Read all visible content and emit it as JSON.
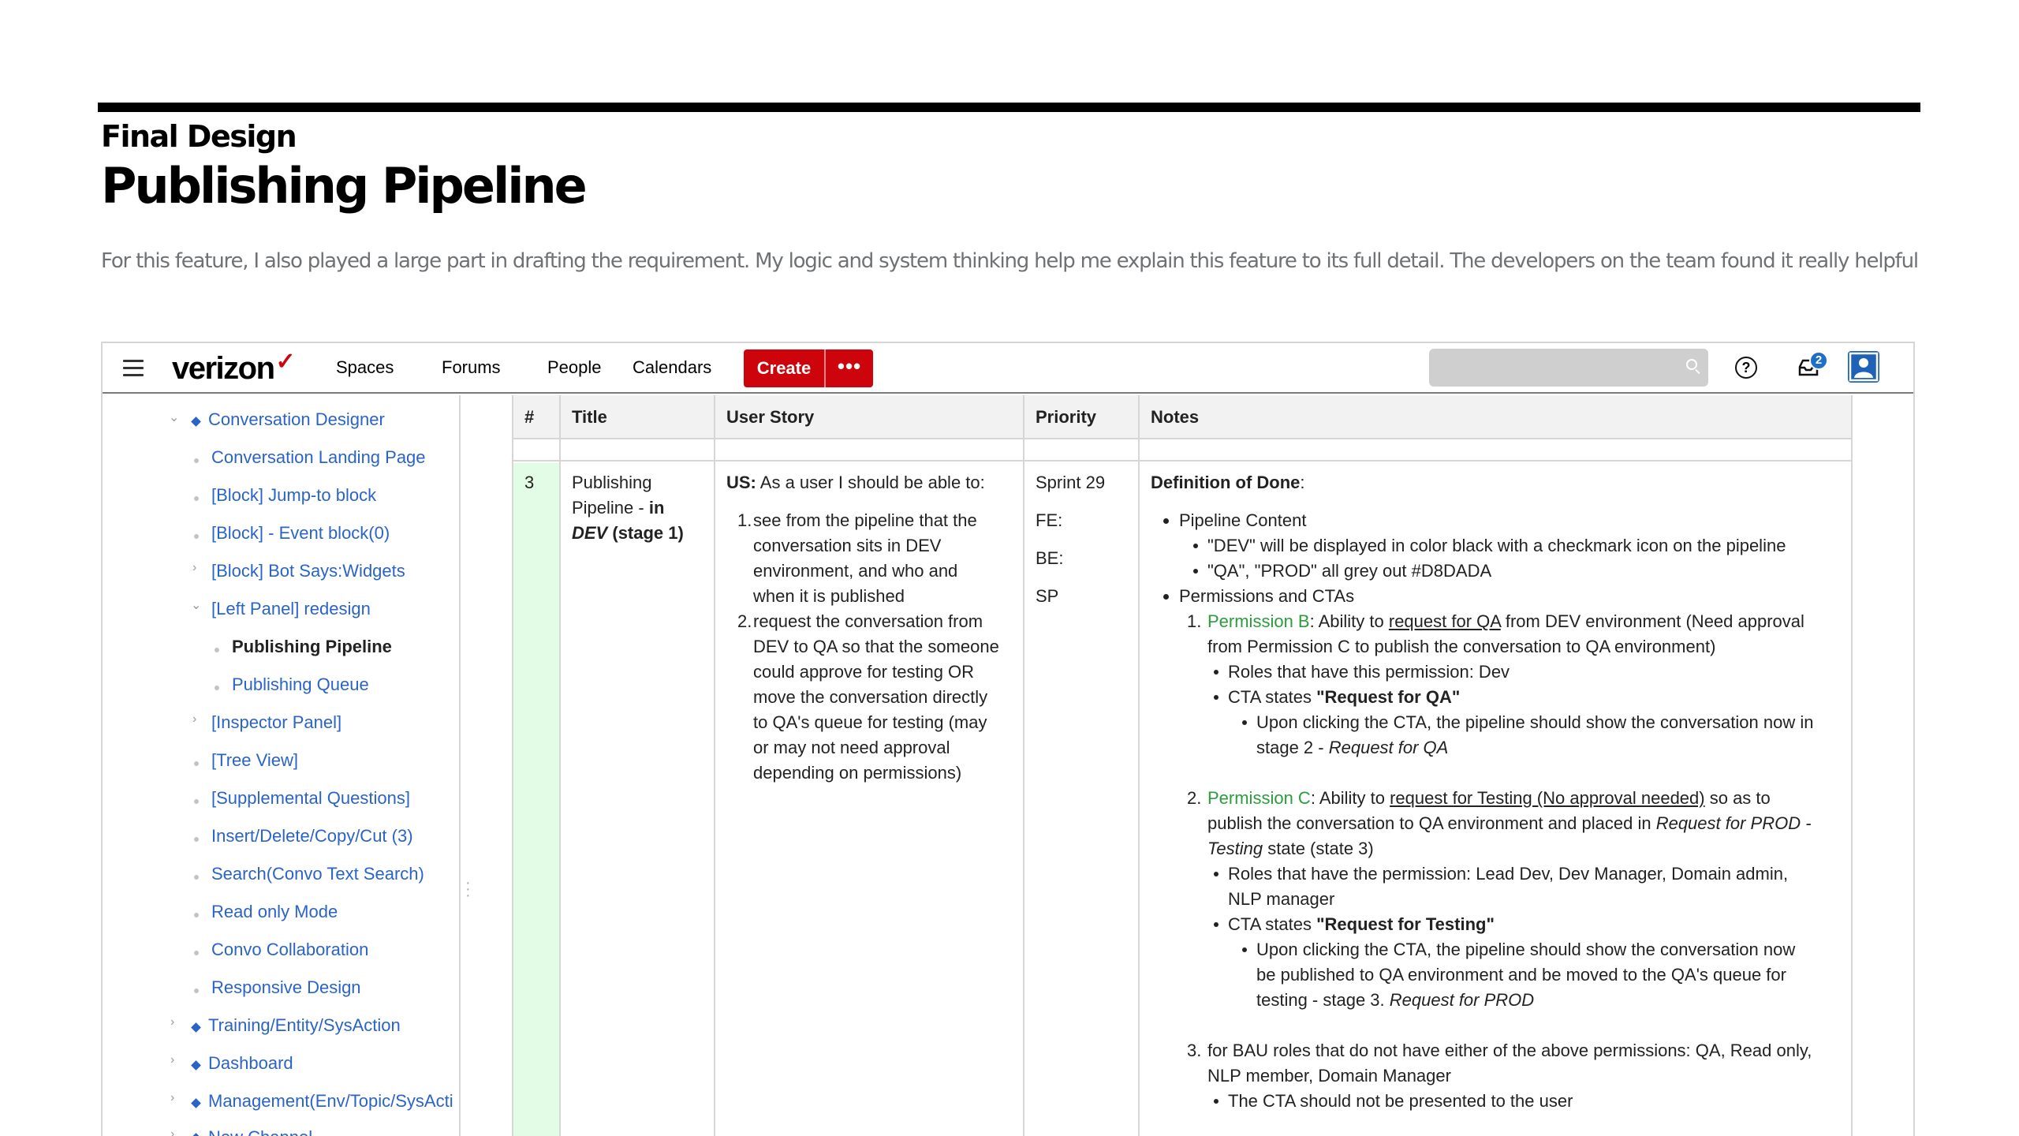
{
  "page": {
    "eyebrow": "Final Design",
    "title": "Publishing Pipeline",
    "intro": "For this feature, I also played a large part in drafting the requirement. My logic and system thinking help me explain this feature to its full detail. The developers on the team found it really helpful"
  },
  "navbar": {
    "logo": "verizon",
    "logo_mark": "✓",
    "links": [
      "Spaces",
      "Forums",
      "People",
      "Calendars"
    ],
    "create_label": "Create",
    "more_label": "•••",
    "notification_count": "2",
    "help_label": "?"
  },
  "sidebar": {
    "items": [
      "Conversation Designer",
      "Conversation Landing Page",
      "[Block] Jump-to block",
      "[Block] - Event block(0)",
      "[Block] Bot Says:Widgets",
      "[Left Panel] redesign",
      "Publishing Pipeline",
      "Publishing Queue",
      "[Inspector Panel]",
      "[Tree View]",
      "[Supplemental Questions]",
      "Insert/Delete/Copy/Cut (3)",
      "Search(Convo Text Search)",
      "Read only Mode",
      "Convo Collaboration",
      "Responsive Design",
      "Training/Entity/SysAction",
      "Dashboard",
      "Management(Env/Topic/SysActi",
      "New Channel"
    ]
  },
  "table": {
    "headers": [
      "#",
      "Title",
      "User Story",
      "Priority",
      "Notes"
    ],
    "row": {
      "num": "3",
      "title_1": "Publishing",
      "title_2a": "Pipeline - ",
      "title_2b": "in",
      "title_3a": "DEV",
      "title_3b": " (stage 1)",
      "story_us_label": "US:",
      "story_us_text": " As a user I should be able to:",
      "story_1_num": "1.",
      "story_1_lines": [
        "see from the pipeline that the",
        "conversation sits in DEV",
        "environment, and who and",
        "when it is published"
      ],
      "story_2_num": "2.",
      "story_2_lines": [
        "request the conversation from",
        "DEV to QA so that the someone",
        "could approve for testing OR",
        "move the conversation directly",
        "to QA's queue for testing (may",
        "or may not need approval",
        "depending on permissions)"
      ],
      "priority": [
        "Sprint 29",
        "FE:",
        "BE:",
        "SP"
      ],
      "notes": {
        "dod_label": "Definition of Done",
        "dod_colon": ":",
        "pipeline_content": "Pipeline Content",
        "pc_1": "\"DEV\" will be displayed in color black with a checkmark icon on the pipeline",
        "pc_2": "\"QA\", \"PROD\" all grey out #D8DADA",
        "perm_ctas": "Permissions and CTAs",
        "p1_num": "1.",
        "p1_name": "Permission B",
        "p1_a": ": Ability to ",
        "p1_link": "request for QA",
        "p1_b": " from DEV environment (Need approval",
        "p1_line2": "from Permission C to publish the conversation to QA environment)",
        "p1_roles": "Roles that have this permission: Dev",
        "p1_cta_a": "CTA states ",
        "p1_cta_b": "\"Request for QA\"",
        "p1_click_1": "Upon clicking the CTA, the pipeline should show the conversation now in",
        "p1_click_2a": "stage 2 - ",
        "p1_click_2b": "Request for QA",
        "p2_num": "2.",
        "p2_name": "Permission C",
        "p2_a": ": Ability to ",
        "p2_link": "request for Testing (No approval needed)",
        "p2_b": " so as to",
        "p2_line2a": "publish the conversation to QA environment and placed in ",
        "p2_line2b": "Request for PROD -",
        "p2_line3a": "Testing",
        "p2_line3b": " state (state 3)",
        "p2_roles_1": "Roles that have the permission: Lead Dev, Dev Manager, Domain admin,",
        "p2_roles_2": "NLP manager",
        "p2_cta_a": "CTA states ",
        "p2_cta_b": "\"Request for Testing\"",
        "p2_click_1": "Upon clicking the CTA, the pipeline should show the conversation now",
        "p2_click_2": "be published to QA environment and be moved to the QA's queue for",
        "p2_click_3a": "testing - stage 3. ",
        "p2_click_3b": "Request for PROD",
        "p3_num": "3.",
        "p3_line1": "for BAU roles that do not have either of the above permissions: QA, Read only,",
        "p3_line2": "NLP member, Domain Manager",
        "p3_sub": "The CTA should not be presented to the user"
      }
    }
  },
  "colors": {
    "brand_red": "#cd040b",
    "link_blue": "#2a63c9",
    "permission_green": "#2c9c3c",
    "row_highlight": "#e3fce6"
  }
}
